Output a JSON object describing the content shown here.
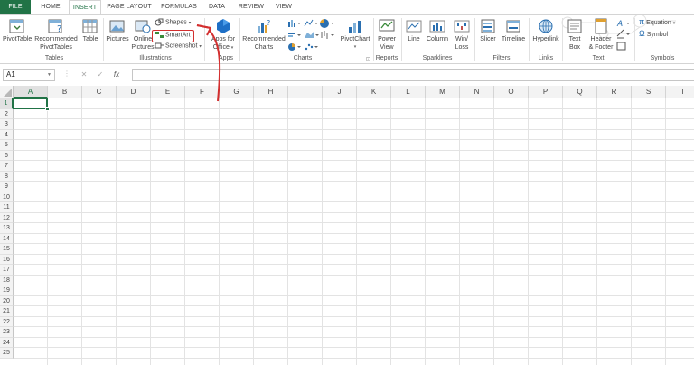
{
  "tabs": [
    "FILE",
    "HOME",
    "INSERT",
    "PAGE LAYOUT",
    "FORMULAS",
    "DATA",
    "REVIEW",
    "VIEW"
  ],
  "active_tab": "INSERT",
  "ribbon": {
    "tables": {
      "pivot": "PivotTable",
      "recommended_1": "Recommended",
      "recommended_2": "PivotTables",
      "table": "Table",
      "label": "Tables"
    },
    "illustrations": {
      "pictures": "Pictures",
      "online_1": "Online",
      "online_2": "Pictures",
      "shapes": "Shapes",
      "smartart": "SmartArt",
      "screenshot": "Screenshot",
      "label": "Illustrations"
    },
    "apps": {
      "apps_1": "Apps for",
      "apps_2": "Office",
      "label": "Apps"
    },
    "charts": {
      "rec_1": "Recommended",
      "rec_2": "Charts",
      "pivotchart": "PivotChart",
      "label": "Charts"
    },
    "reports": {
      "power_1": "Power",
      "power_2": "View",
      "label": "Reports"
    },
    "sparklines": {
      "line": "Line",
      "column": "Column",
      "winloss_1": "Win/",
      "winloss_2": "Loss",
      "label": "Sparklines"
    },
    "filters": {
      "slicer": "Slicer",
      "timeline": "Timeline",
      "label": "Filters"
    },
    "links": {
      "hyperlink": "Hyperlink",
      "label": "Links"
    },
    "text": {
      "textbox_1": "Text",
      "textbox_2": "Box",
      "header_1": "Header",
      "header_2": "& Footer",
      "label": "Text"
    },
    "symbols": {
      "equation": "Equation",
      "symbol": "Symbol",
      "label": "Symbols"
    }
  },
  "formula_bar": {
    "name_box": "A1",
    "fx": "fx",
    "value": ""
  },
  "columns": [
    "A",
    "B",
    "C",
    "D",
    "E",
    "F",
    "G",
    "H",
    "I",
    "J",
    "K",
    "L",
    "M",
    "N",
    "O",
    "P",
    "Q",
    "R",
    "S",
    "T"
  ],
  "rows": [
    "1",
    "2",
    "3",
    "4",
    "5",
    "6",
    "7",
    "8",
    "9",
    "10",
    "11",
    "12",
    "13",
    "14",
    "15",
    "16",
    "17",
    "18",
    "19",
    "20",
    "21",
    "22",
    "23",
    "24",
    "25"
  ],
  "selected_cell": "A1",
  "colors": {
    "accent": "#217346",
    "annotation": "#d32f2f"
  }
}
